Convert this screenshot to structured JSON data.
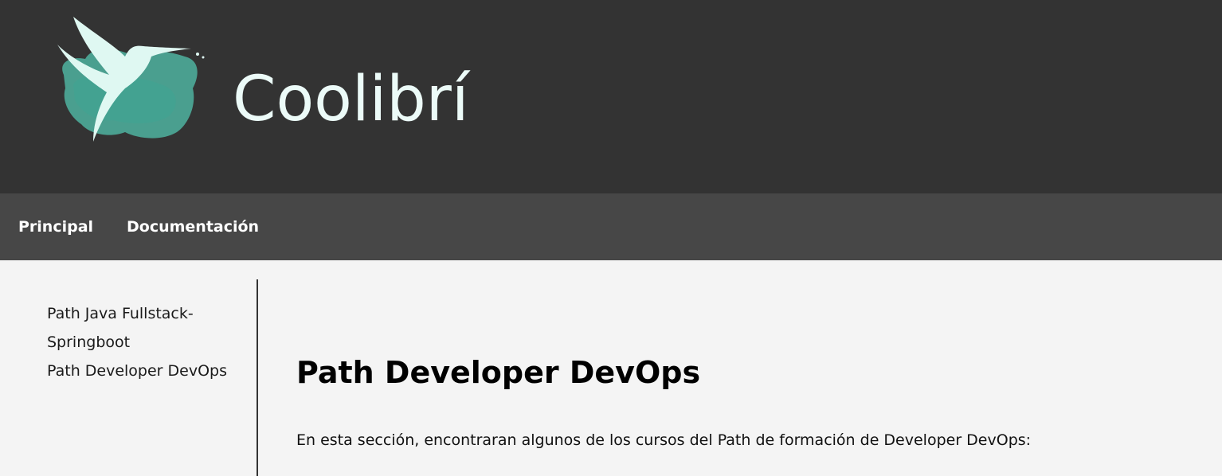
{
  "header": {
    "site_title": "Coolibrí",
    "logo_icon": "hummingbird-logo-icon",
    "background_color": "#333333",
    "accent_color": "#5fc4b0"
  },
  "navbar": {
    "items": [
      {
        "label": "Principal"
      },
      {
        "label": "Documentación"
      }
    ],
    "background_color": "#474747"
  },
  "sidebar": {
    "items": [
      {
        "label": "Path Java Fullstack-Springboot"
      },
      {
        "label": "Path Developer DevOps"
      }
    ]
  },
  "main": {
    "title": "Path Developer DevOps",
    "intro": "En esta sección, encontraran algunos de los cursos del Path de formación de Developer DevOps:"
  }
}
